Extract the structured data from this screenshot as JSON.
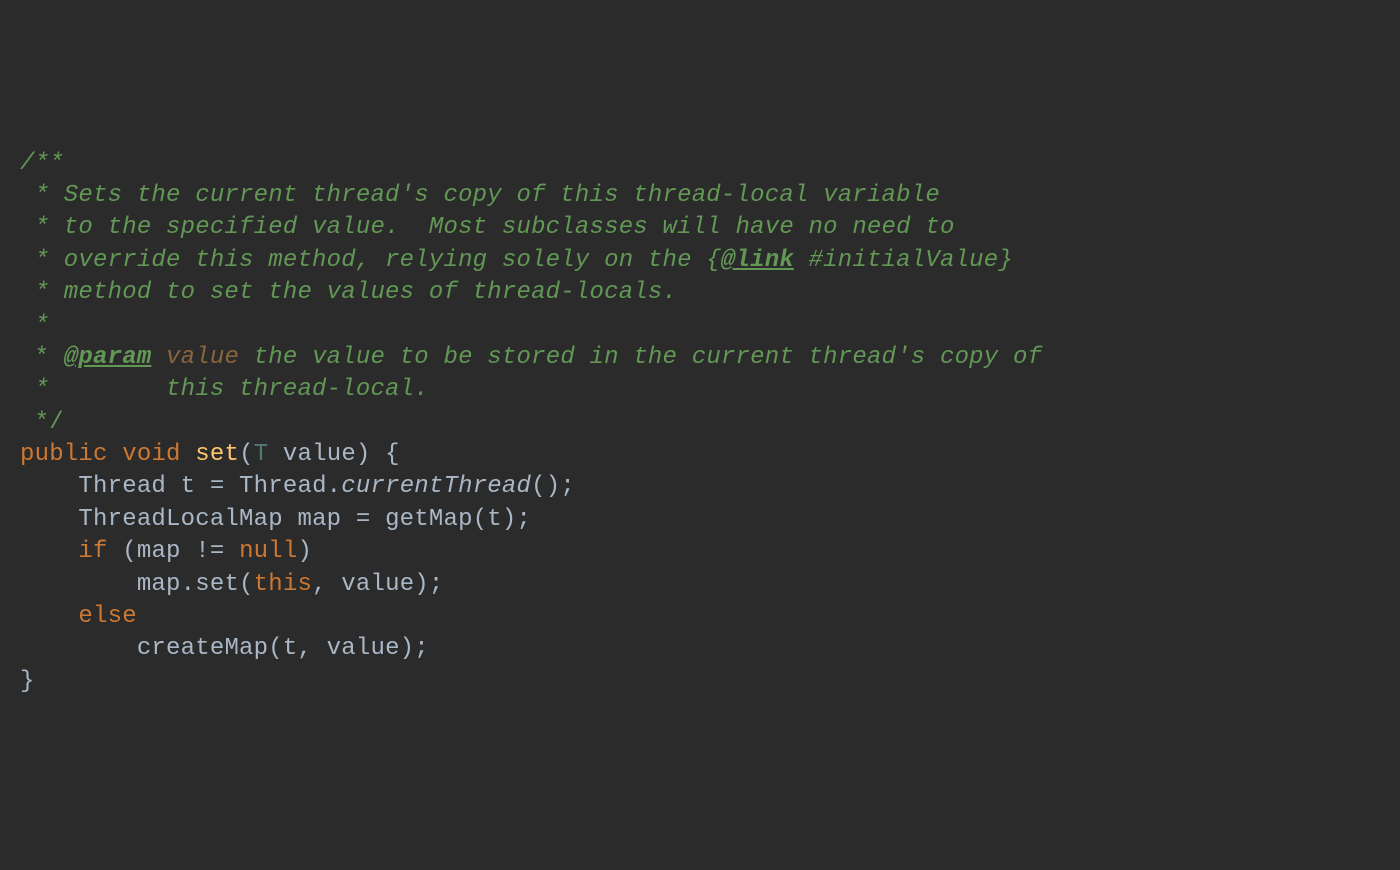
{
  "doc": {
    "open": "/**",
    "l1": " * Sets the current thread's copy of this thread-local variable",
    "l2": " * to the specified value.  Most subclasses will have no need to",
    "l3a": " * override this method, relying solely on the {",
    "l3_tag": "@link",
    "l3b": " #initialValue",
    "l3c": "}",
    "l4": " * method to set the values of thread-locals.",
    "l5": " *",
    "l6a": " * ",
    "l6_tag": "@param",
    "l6_space": " ",
    "l6_param": "value",
    "l6b": " the value to be stored in the current thread's copy of",
    "l7": " *        this thread-local.",
    "close": " */"
  },
  "code": {
    "sig": {
      "public": "public",
      "void": "void",
      "name": "set",
      "paren_open": "(",
      "generic": "T",
      "space": " ",
      "param": "value",
      "paren_close_brace": ") {"
    },
    "l1": {
      "indent": "    ",
      "type": "Thread",
      "var": " t = Thread.",
      "call": "currentThread",
      "after": "();"
    },
    "l2": {
      "indent": "    ",
      "type": "ThreadLocalMap",
      "rest": " map = getMap(t);"
    },
    "l3": {
      "indent": "    ",
      "kw": "if",
      "rest1": " (map != ",
      "null": "null",
      "rest2": ")"
    },
    "l4": {
      "indent": "        ",
      "before": "map.set(",
      "this": "this",
      "after": ", value);"
    },
    "l5": {
      "indent": "    ",
      "kw": "else"
    },
    "l6": {
      "indent": "        ",
      "rest": "createMap(t, value);"
    },
    "close": "}"
  }
}
